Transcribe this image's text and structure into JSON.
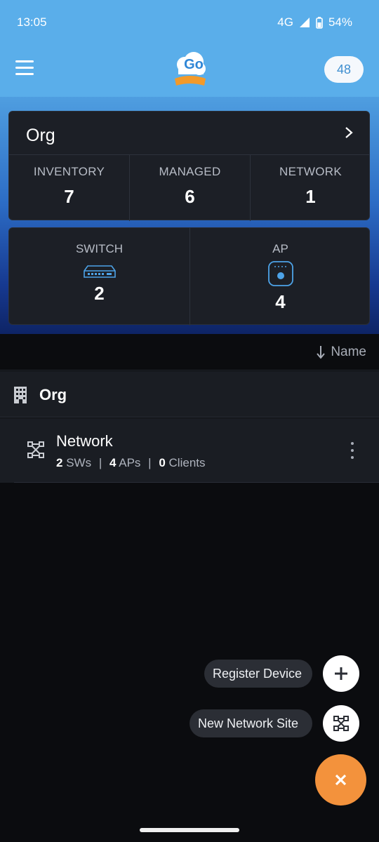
{
  "status": {
    "time": "13:05",
    "network": "4G",
    "battery": "54%"
  },
  "header": {
    "notification_count": "48",
    "logo_text": "Go"
  },
  "org_card": {
    "title": "Org",
    "stats": [
      {
        "label": "INVENTORY",
        "value": "7"
      },
      {
        "label": "MANAGED",
        "value": "6"
      },
      {
        "label": "NETWORK",
        "value": "1"
      }
    ]
  },
  "device_card": {
    "switch": {
      "label": "SWITCH",
      "value": "2",
      "icon": "switch-icon"
    },
    "ap": {
      "label": "AP",
      "value": "4",
      "icon": "access-point-icon"
    }
  },
  "sort": {
    "label": "Name"
  },
  "tree": {
    "org": {
      "label": "Org"
    },
    "network": {
      "title": "Network",
      "sws_count": "2",
      "sws_label": "SWs",
      "aps_count": "4",
      "aps_label": "APs",
      "clients_count": "0",
      "clients_label": "Clients",
      "sep": "|"
    }
  },
  "fab": {
    "register_device": "Register Device",
    "new_network_site": "New Network Site"
  },
  "colors": {
    "header_blue": "#5aaeea",
    "accent_orange": "#f3923c",
    "icon_blue": "#4da3e8"
  }
}
